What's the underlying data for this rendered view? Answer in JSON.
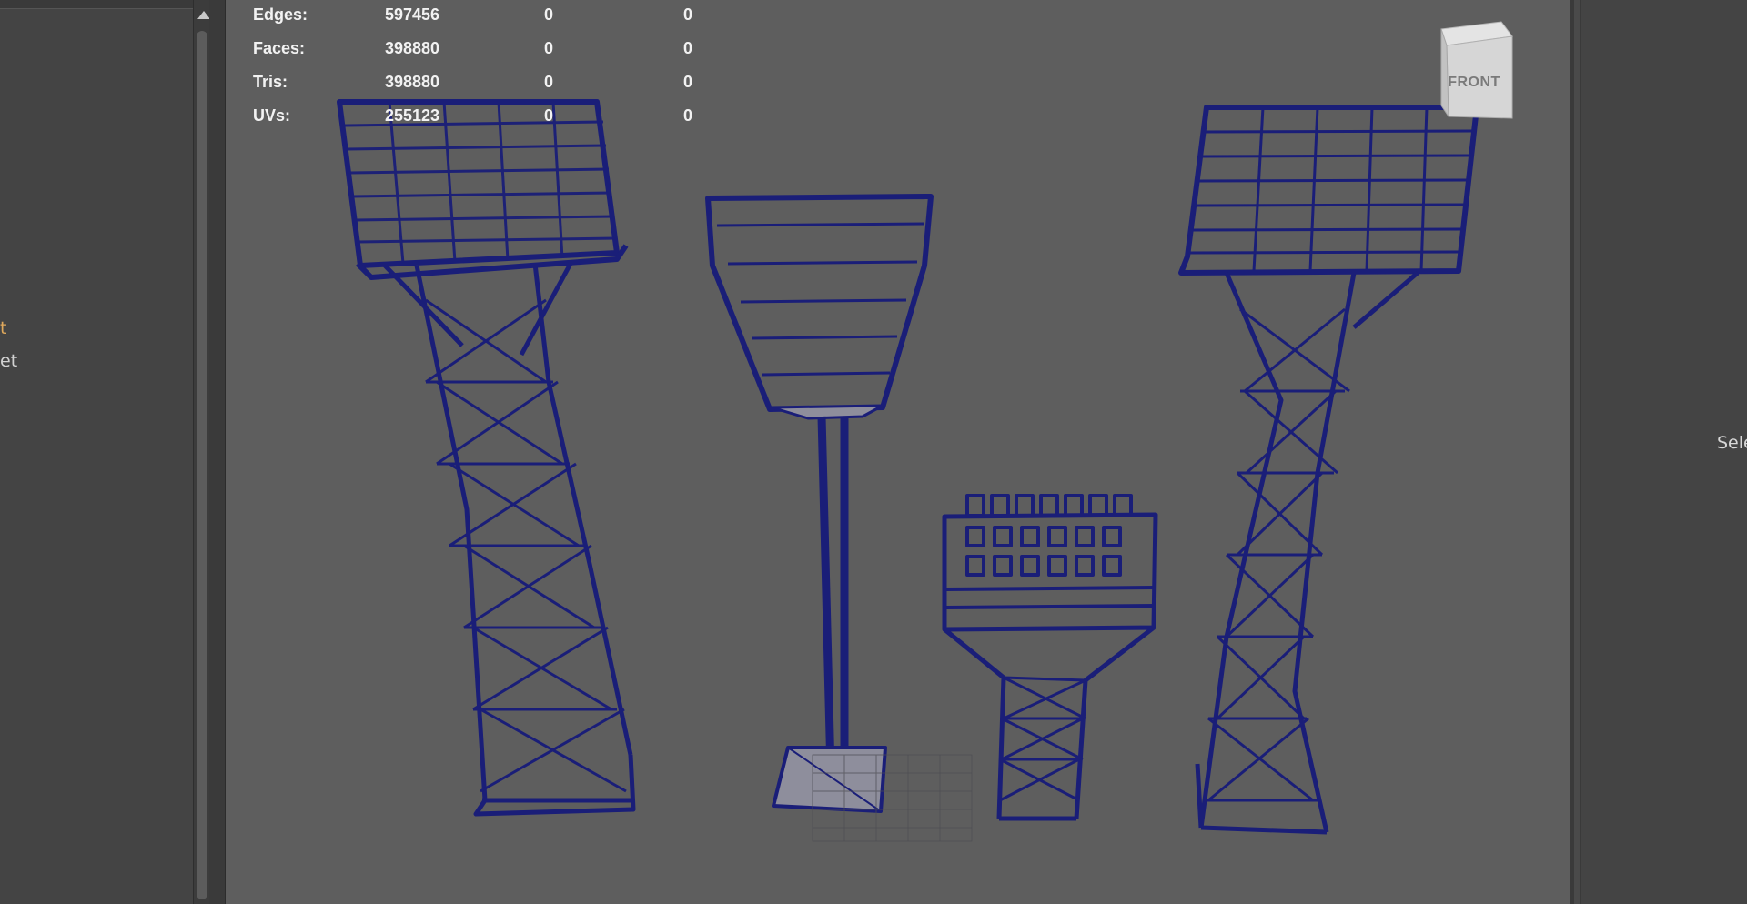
{
  "outliner": {
    "items": [
      {
        "text": "t",
        "state": "highlighted"
      },
      {
        "text": "et",
        "state": "normal"
      }
    ]
  },
  "viewport": {
    "hud": [
      {
        "label": "Edges:",
        "values": [
          "597456",
          "0",
          "0"
        ]
      },
      {
        "label": "Faces:",
        "values": [
          "398880",
          "0",
          "0"
        ]
      },
      {
        "label": "Tris:",
        "values": [
          "398880",
          "0",
          "0"
        ]
      },
      {
        "label": "UVs:",
        "values": [
          "255123",
          "0",
          "0"
        ]
      }
    ],
    "view_cube_label": "FRONT",
    "wireframe_color": "#1a1e78",
    "background_color": "#5e5e5e"
  },
  "right_panel": {
    "text": "Sele"
  }
}
